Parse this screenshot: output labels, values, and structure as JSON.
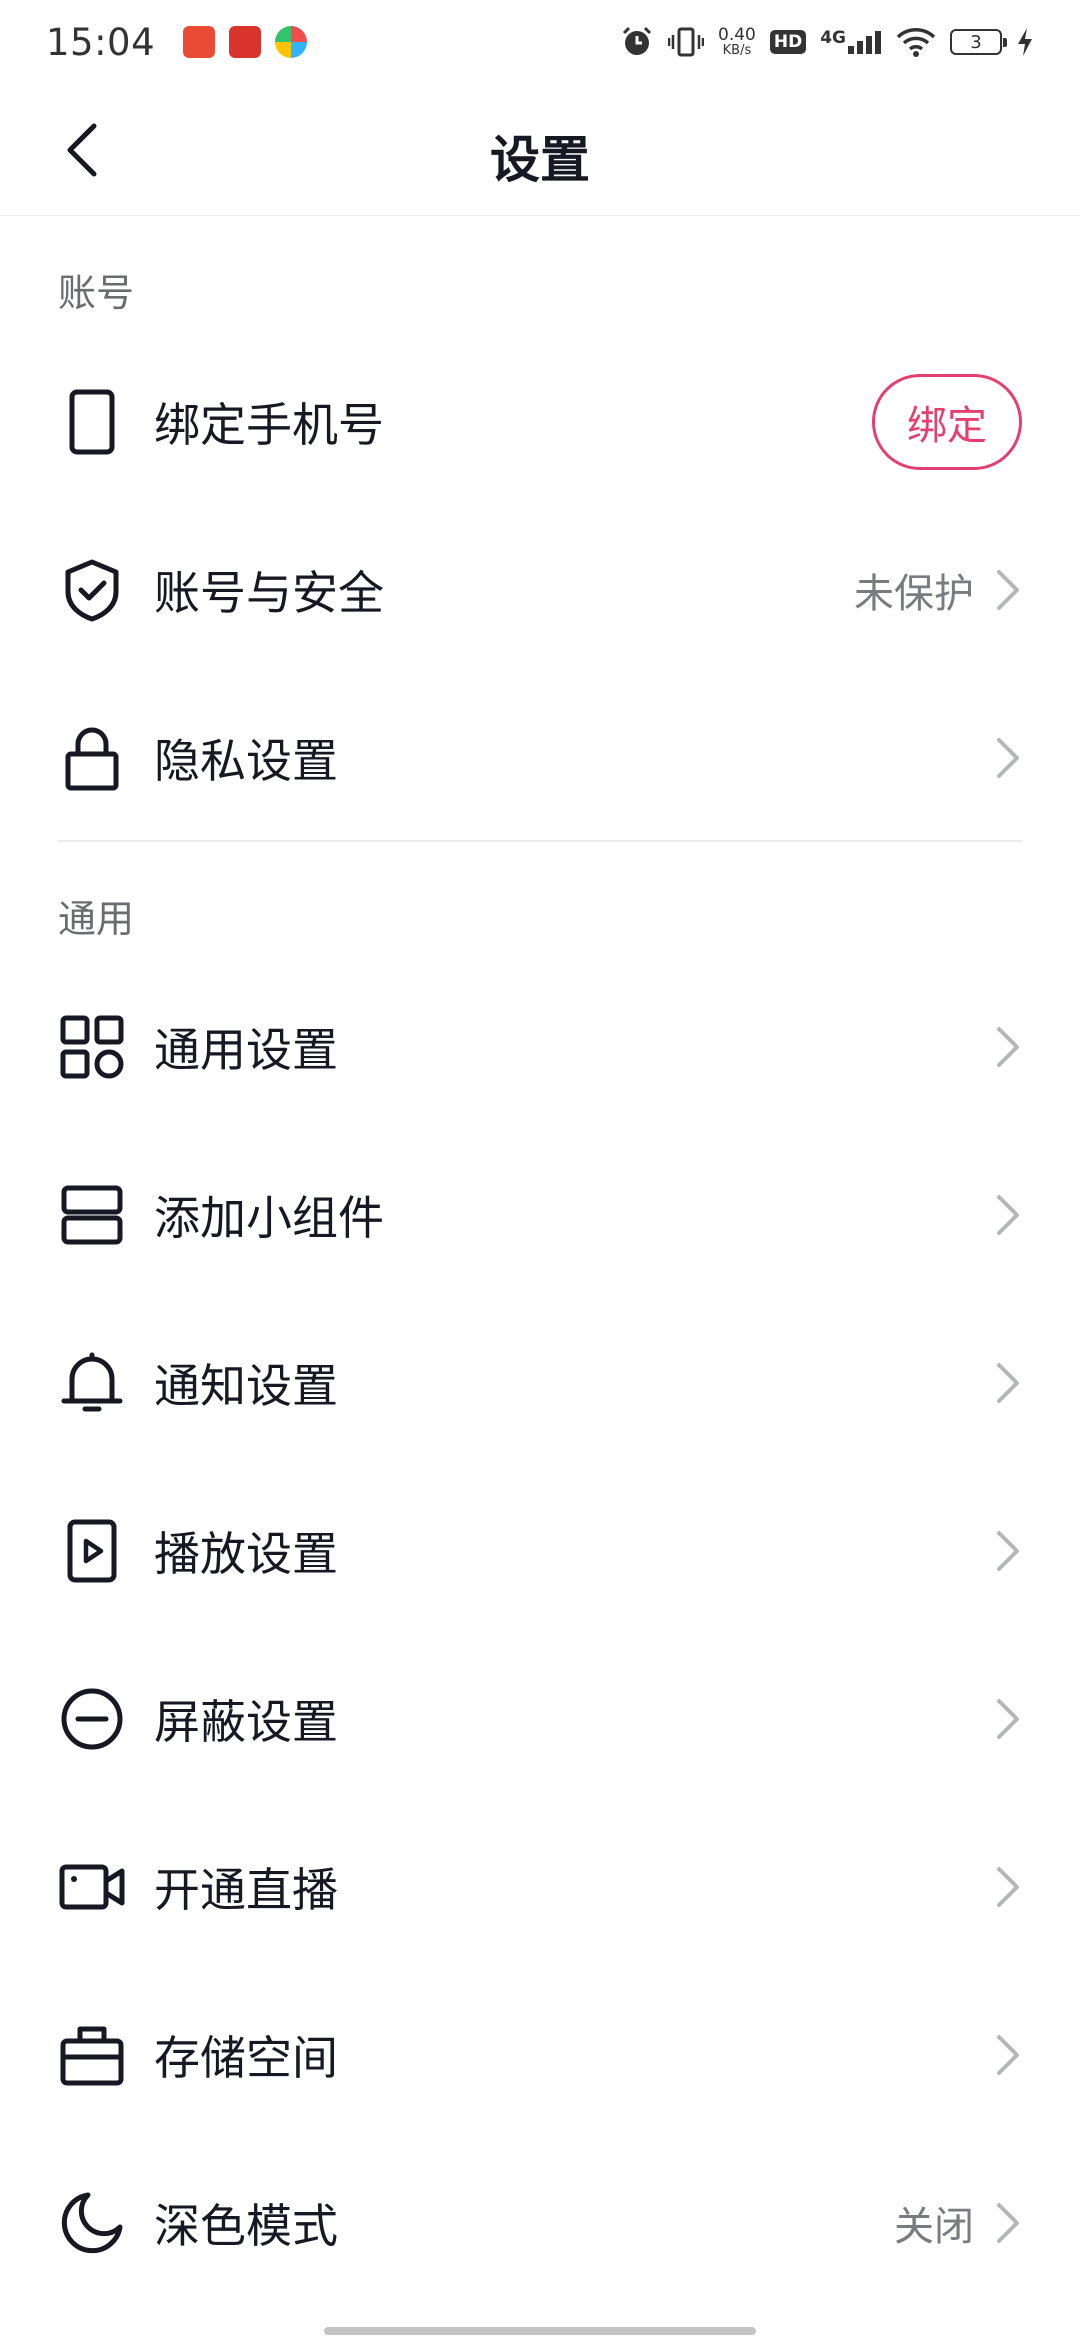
{
  "status_bar": {
    "time": "15:04",
    "speed_value": "0.40",
    "speed_unit": "KB/s",
    "hd": "HD",
    "network": "4G",
    "battery": "3"
  },
  "header": {
    "title": "设置"
  },
  "sections": [
    {
      "title": "账号",
      "items": [
        {
          "label": "绑定手机号",
          "icon": "phone-icon",
          "action": "绑定"
        },
        {
          "label": "账号与安全",
          "icon": "shield-check-icon",
          "value": "未保护"
        },
        {
          "label": "隐私设置",
          "icon": "lock-icon"
        }
      ]
    },
    {
      "title": "通用",
      "items": [
        {
          "label": "通用设置",
          "icon": "grid-icon"
        },
        {
          "label": "添加小组件",
          "icon": "widget-icon"
        },
        {
          "label": "通知设置",
          "icon": "bell-icon"
        },
        {
          "label": "播放设置",
          "icon": "play-icon"
        },
        {
          "label": "屏蔽设置",
          "icon": "block-icon"
        },
        {
          "label": "开通直播",
          "icon": "video-camera-icon"
        },
        {
          "label": "存储空间",
          "icon": "storage-icon"
        },
        {
          "label": "深色模式",
          "icon": "moon-icon",
          "value": "关闭"
        }
      ]
    }
  ],
  "colors": {
    "accent": "#e4406f",
    "text_primary": "#161823",
    "text_secondary": "#6b6c72"
  }
}
